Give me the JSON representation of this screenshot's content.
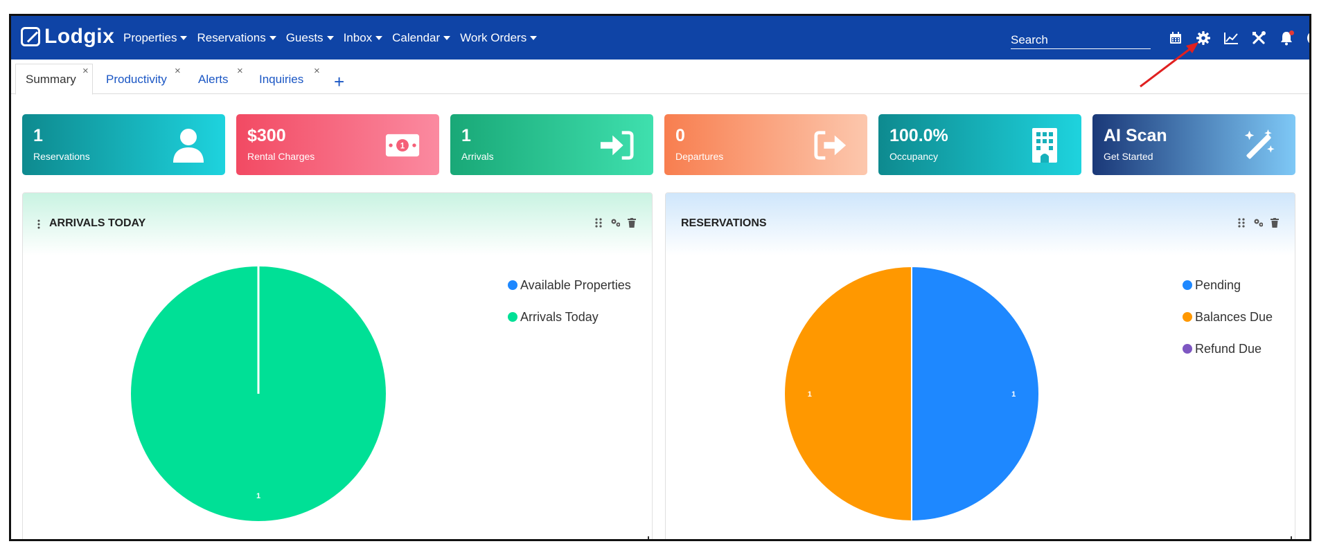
{
  "brand": {
    "name": "Lodgix"
  },
  "nav": {
    "menu": [
      {
        "label": "Properties"
      },
      {
        "label": "Reservations"
      },
      {
        "label": "Guests"
      },
      {
        "label": "Inbox"
      },
      {
        "label": "Calendar"
      },
      {
        "label": "Work Orders"
      }
    ],
    "search": {
      "placeholder": "Search",
      "value": ""
    },
    "icons": [
      "calendar-icon",
      "gear-icon",
      "line-chart-icon",
      "tools-icon",
      "bell-icon",
      "user-circle-icon"
    ]
  },
  "tabs": [
    {
      "label": "Summary",
      "active": true
    },
    {
      "label": "Productivity",
      "active": false
    },
    {
      "label": "Alerts",
      "active": false
    },
    {
      "label": "Inquiries",
      "active": false
    }
  ],
  "tab_close_glyph": "×",
  "tab_add_glyph": "+",
  "stats": [
    {
      "value": "1",
      "label": "Reservations",
      "icon": "user-icon",
      "gradient": [
        "#0e8a8f",
        "#1ed3de"
      ]
    },
    {
      "value": "$300",
      "label": "Rental Charges",
      "icon": "money-bill-icon",
      "gradient": [
        "#f24a63",
        "#fb8aa0"
      ]
    },
    {
      "value": "1",
      "label": "Arrivals",
      "icon": "sign-in-icon",
      "gradient": [
        "#19a877",
        "#3fe0ae"
      ]
    },
    {
      "value": "0",
      "label": "Departures",
      "icon": "sign-out-icon",
      "gradient": [
        "#f87e4f",
        "#fcc7ad"
      ]
    },
    {
      "value": "100.0%",
      "label": "Occupancy",
      "icon": "building-icon",
      "gradient": [
        "#0e8a8f",
        "#1ed3de"
      ]
    },
    {
      "value": "AI Scan",
      "label": "Get Started",
      "icon": "magic-wand-icon",
      "gradient": [
        "#1a3878",
        "#7ec8f6"
      ]
    }
  ],
  "panels": {
    "arrivals": {
      "title": "ARRIVALS TODAY",
      "legend": [
        {
          "label": "Available Properties",
          "color": "#1e88ff"
        },
        {
          "label": "Arrivals Today",
          "color": "#00e096"
        }
      ]
    },
    "reservations": {
      "title": "RESERVATIONS",
      "legend": [
        {
          "label": "Pending",
          "color": "#1e88ff"
        },
        {
          "label": "Balances Due",
          "color": "#ff9800"
        },
        {
          "label": "Refund Due",
          "color": "#7e57c2"
        }
      ]
    }
  },
  "chart_data": [
    {
      "type": "pie",
      "title": "ARRIVALS TODAY",
      "categories": [
        "Available Properties",
        "Arrivals Today"
      ],
      "values": [
        0,
        1
      ],
      "colors": [
        "#1e88ff",
        "#00e096"
      ],
      "data_labels": [
        "",
        "1"
      ]
    },
    {
      "type": "pie",
      "title": "RESERVATIONS",
      "categories": [
        "Pending",
        "Balances Due",
        "Refund Due"
      ],
      "values": [
        1,
        1,
        0
      ],
      "colors": [
        "#1e88ff",
        "#ff9800",
        "#7e57c2"
      ],
      "data_labels": [
        "1",
        "1",
        ""
      ]
    }
  ],
  "colors": {
    "navbar": "#0f44a6",
    "link": "#1a56c4",
    "annotation_arrow": "#e02020"
  }
}
